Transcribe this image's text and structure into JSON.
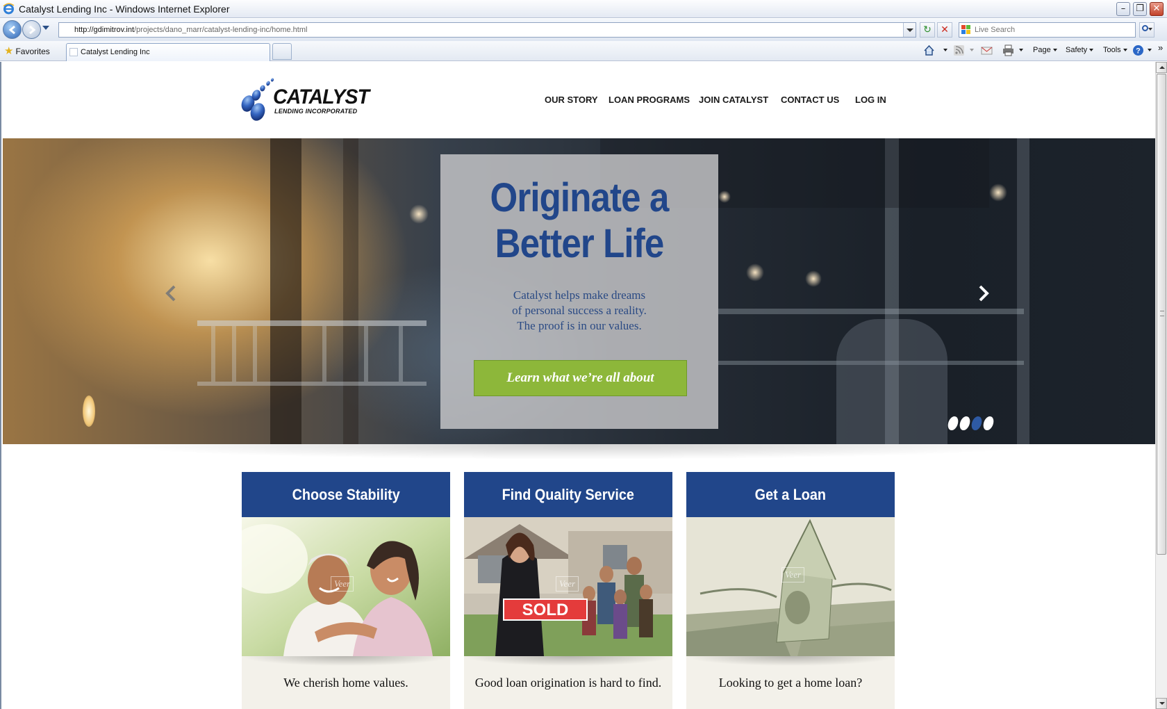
{
  "browser": {
    "window_title": "Catalyst Lending Inc - Windows Internet Explorer",
    "url_host": "http://gdimitrov.int",
    "url_path": "/projects/dano_marr/catalyst-lending-inc/home.html",
    "search_placeholder": "Live Search",
    "favorites_label": "Favorites",
    "tab_title": "Catalyst Lending Inc",
    "commands": {
      "page": "Page",
      "safety": "Safety",
      "tools": "Tools"
    }
  },
  "site": {
    "logo_word": "CATALYST",
    "logo_sub": "LENDING INCORPORATED",
    "nav": [
      "OUR STORY",
      "LOAN PROGRAMS",
      "JOIN CATALYST",
      "CONTACT US",
      "LOG IN"
    ],
    "hero": {
      "title_line1": "Originate a",
      "title_line2": "Better Life",
      "text_line1": "Catalyst helps make dreams",
      "text_line2": "of personal success a reality.",
      "text_line3": "The proof is in our values.",
      "cta": "Learn what we’re all about",
      "slides": 4,
      "active_slide": 3
    },
    "cards": [
      {
        "title": "Choose Stability",
        "caption": "We cherish home values.",
        "watermark": "Veer"
      },
      {
        "title": "Find Quality Service",
        "caption": "Good loan origination is hard to find.",
        "watermark": "Veer",
        "sign": "SOLD"
      },
      {
        "title": "Get a Loan",
        "caption": "Looking to get a home loan?",
        "watermark": "Veer"
      }
    ]
  },
  "colors": {
    "brand_blue": "#21468a",
    "cta_green": "#8db73a",
    "card_footer": "#f3f1ea"
  }
}
